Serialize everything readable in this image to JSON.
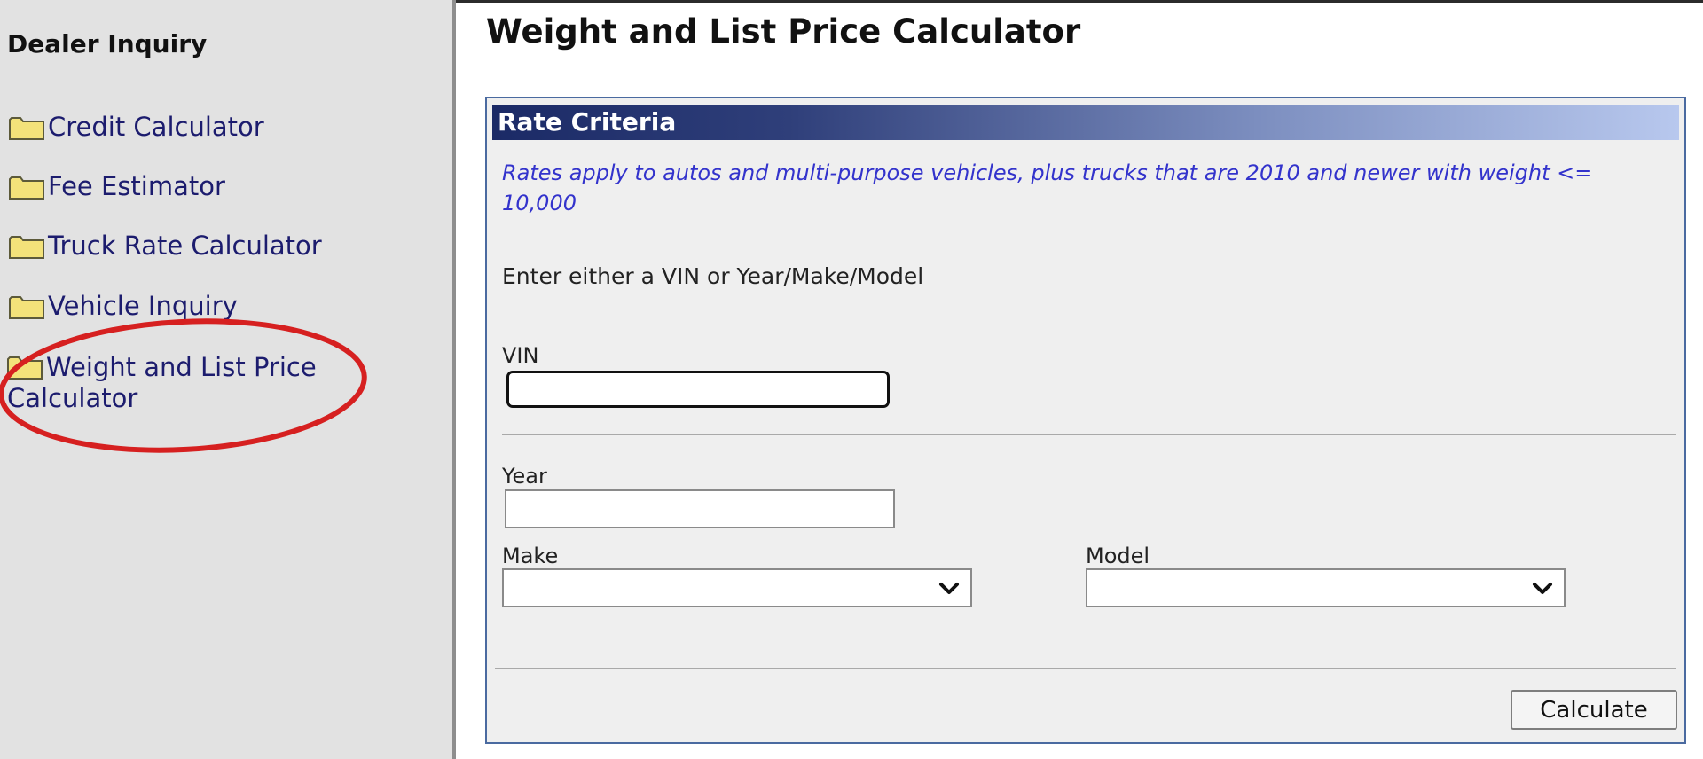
{
  "sidebar": {
    "title": "Dealer Inquiry",
    "items": [
      {
        "label": "Credit Calculator",
        "icon": "folder-icon"
      },
      {
        "label": "Fee Estimator",
        "icon": "folder-icon"
      },
      {
        "label": "Truck Rate Calculator",
        "icon": "folder-icon"
      },
      {
        "label": "Vehicle Inquiry",
        "icon": "folder-icon"
      },
      {
        "label": "Weight and List Price Calculator",
        "icon": "folder-icon"
      }
    ],
    "highlight_color": "#d62020"
  },
  "main": {
    "title": "Weight and List Price Calculator",
    "panel": {
      "header": "Rate Criteria",
      "note": "Rates apply to autos and multi-purpose vehicles, plus trucks that are 2010 and newer with weight <= 10,000",
      "instruction": "Enter either a VIN or Year/Make/Model",
      "vin_label": "VIN",
      "vin_value": "",
      "year_label": "Year",
      "year_value": "",
      "make_label": "Make",
      "make_value": "",
      "model_label": "Model",
      "model_value": "",
      "calculate_label": "Calculate"
    }
  },
  "colors": {
    "sidebar_bg": "#e2e2e2",
    "link": "#1c1c6e",
    "header_dark": "#1b2a66",
    "note_text": "#3333cc"
  }
}
